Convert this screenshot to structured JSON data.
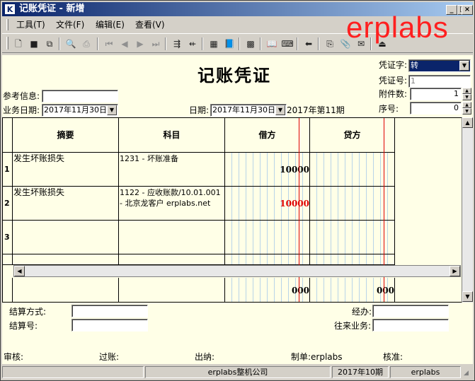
{
  "window": {
    "app_icon": "K",
    "title": "记账凭证 - 新增",
    "watermark": "erplabs"
  },
  "menu": [
    "工具(T)",
    "文件(F)",
    "编辑(E)",
    "查看(V)"
  ],
  "toolbar": {
    "icons": [
      "new-icon",
      "save-icon",
      "save-all-icon",
      "print-preview-icon",
      "print-icon",
      "first-record-icon",
      "previous-record-icon",
      "next-record-icon",
      "last-record-icon",
      "insert-row-icon",
      "delete-row-icon",
      "calculator-icon",
      "book-icon",
      "grid-icon",
      "open-book-icon",
      "keyboard-icon",
      "arrow-left-icon",
      "copy-icon",
      "attach-icon",
      "mail-icon",
      "exit-icon"
    ]
  },
  "voucher": {
    "title": "记账凭证",
    "voucher_type_label": "凭证字:",
    "voucher_type_value": "转",
    "voucher_no_label": "凭证号:",
    "voucher_no_value": "1",
    "attachments_label": "附件数:",
    "attachments_value": "1",
    "seq_label": "序号:",
    "seq_value": "0",
    "ref_info_label": "参考信息:",
    "ref_info_value": "",
    "business_date_label": "业务日期:",
    "business_date_value": "2017年11月30日",
    "date_label": "日期:",
    "date_value": "2017年11月30日",
    "period_text": "2017年第11期"
  },
  "grid": {
    "headers": {
      "summary": "摘要",
      "account": "科目",
      "debit": "借方",
      "credit": "贷方"
    },
    "rows": [
      {
        "no": "1",
        "summary": "发生坏账损失",
        "account": "1231 - 坏账准备",
        "debit": "10000",
        "credit": "",
        "debit_color": "#000000"
      },
      {
        "no": "2",
        "summary": "发生坏账损失",
        "account": "1122 - 应收账款/10.01.001 - 北京龙客户 erplabs.net",
        "debit": "10000",
        "credit": "",
        "debit_color": "#e00000"
      },
      {
        "no": "3",
        "summary": "",
        "account": "",
        "debit": "",
        "credit": "",
        "debit_color": "#000000"
      }
    ],
    "total_debit": "000",
    "total_credit": "000"
  },
  "settlement": {
    "method_label": "结算方式:",
    "method_value": "",
    "no_label": "结算号:",
    "no_value": "",
    "handler_label": "经办:",
    "handler_value": "",
    "partner_label": "往来业务:",
    "partner_value": ""
  },
  "signatures": {
    "audit": "审核:",
    "posting": "过账:",
    "cashier": "出纳:",
    "maker": "制单:erplabs",
    "approve": "核准:"
  },
  "status": {
    "pane1": "",
    "company": "erplabs整机公司",
    "period": "2017年10期",
    "user": "erplabs"
  }
}
